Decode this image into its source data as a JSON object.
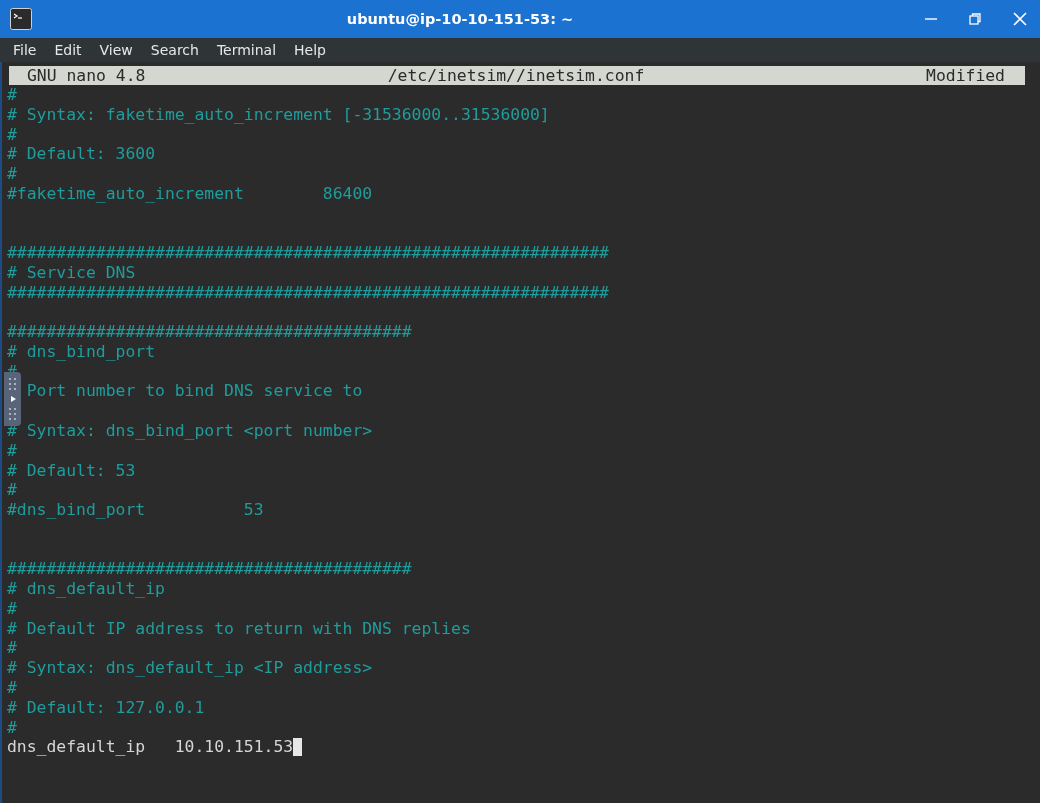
{
  "window": {
    "title": "ubuntu@ip-10-10-151-53: ~"
  },
  "menu": [
    "File",
    "Edit",
    "View",
    "Search",
    "Terminal",
    "Help"
  ],
  "nano_header": {
    "version": "GNU nano 4.8",
    "file": "/etc/inetsim//inetsim.conf",
    "status": "Modified"
  },
  "lines": [
    {
      "kind": "comment",
      "text": "#"
    },
    {
      "kind": "comment",
      "text": "# Syntax: faketime_auto_increment [-31536000..31536000]"
    },
    {
      "kind": "comment",
      "text": "#"
    },
    {
      "kind": "comment",
      "text": "# Default: 3600"
    },
    {
      "kind": "comment",
      "text": "#"
    },
    {
      "kind": "comment",
      "text": "#faketime_auto_increment        86400"
    },
    {
      "kind": "blank"
    },
    {
      "kind": "blank"
    },
    {
      "kind": "comment",
      "text": "#############################################################"
    },
    {
      "kind": "comment",
      "text": "# Service DNS"
    },
    {
      "kind": "comment",
      "text": "#############################################################"
    },
    {
      "kind": "blank"
    },
    {
      "kind": "comment",
      "text": "#########################################"
    },
    {
      "kind": "comment",
      "text": "# dns_bind_port"
    },
    {
      "kind": "comment",
      "text": "#"
    },
    {
      "kind": "comment",
      "text": "  Port number to bind DNS service to"
    },
    {
      "kind": "blank"
    },
    {
      "kind": "comment",
      "text": "# Syntax: dns_bind_port <port number>"
    },
    {
      "kind": "comment",
      "text": "#"
    },
    {
      "kind": "comment",
      "text": "# Default: 53"
    },
    {
      "kind": "comment",
      "text": "#"
    },
    {
      "kind": "comment",
      "text": "#dns_bind_port          53"
    },
    {
      "kind": "blank"
    },
    {
      "kind": "blank"
    },
    {
      "kind": "comment",
      "text": "#########################################"
    },
    {
      "kind": "comment",
      "text": "# dns_default_ip"
    },
    {
      "kind": "comment",
      "text": "#"
    },
    {
      "kind": "comment",
      "text": "# Default IP address to return with DNS replies"
    },
    {
      "kind": "comment",
      "text": "#"
    },
    {
      "kind": "comment",
      "text": "# Syntax: dns_default_ip <IP address>"
    },
    {
      "kind": "comment",
      "text": "#"
    },
    {
      "kind": "comment",
      "text": "# Default: 127.0.0.1"
    },
    {
      "kind": "comment",
      "text": "#"
    },
    {
      "kind": "setting",
      "text": "dns_default_ip   10.10.151.53",
      "cursor": true
    }
  ]
}
